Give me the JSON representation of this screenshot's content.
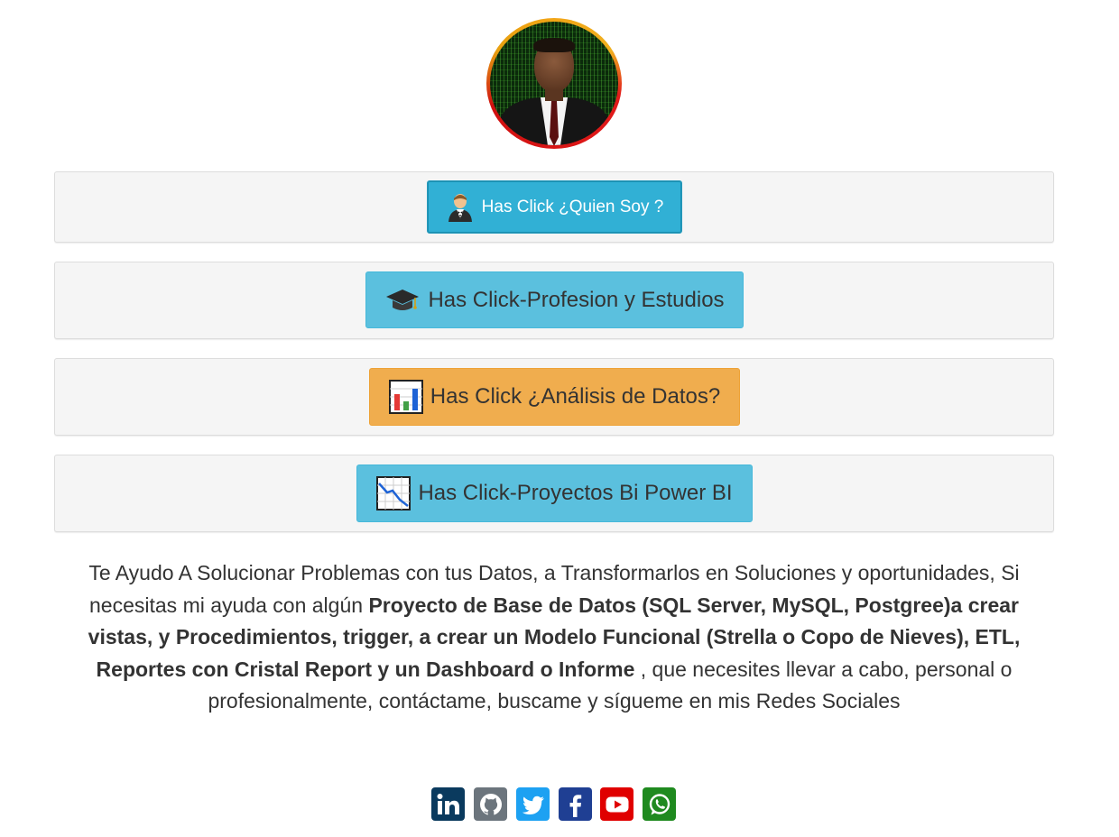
{
  "profile": {
    "photo_alt": "profile photo"
  },
  "buttons": [
    {
      "label": "Has Click ¿Quien Soy ?",
      "icon": "man-in-tuxedo-icon",
      "color": "#31b0d5"
    },
    {
      "label": "Has Click-Profesion y Estudios",
      "icon": "graduation-cap-icon",
      "color": "#5bc0de"
    },
    {
      "label": "Has Click ¿Análisis de Datos?",
      "icon": "bar-chart-icon",
      "color": "#f0ad4e"
    },
    {
      "label": "Has Click-Proyectos Bi Power BI",
      "icon": "chart-decreasing-icon",
      "color": "#5bc0de"
    }
  ],
  "description": {
    "part1": "Te Ayudo A Solucionar Problemas con tus Datos, a Transformarlos en Soluciones y oportunidades, Si necesitas mi ayuda con algún ",
    "bold": "Proyecto de Base de Datos (SQL Server, MySQL, Postgree)a crear vistas, y Procedimientos, trigger, a crear un Modelo Funcional (Strella o Copo de Nieves), ETL, Reportes con Cristal Report y un Dashboard o Informe",
    "part2": " , que necesites llevar a cabo, personal o profesionalmente, contáctame, buscame y sígueme en mis Redes Sociales"
  },
  "social": [
    {
      "name": "linkedin",
      "color": "#0a3a5e"
    },
    {
      "name": "github",
      "color": "#6c757d"
    },
    {
      "name": "twitter",
      "color": "#1da1f2"
    },
    {
      "name": "facebook",
      "color": "#1f3f93"
    },
    {
      "name": "youtube",
      "color": "#e00000"
    },
    {
      "name": "whatsapp",
      "color": "#1f8a1f"
    }
  ]
}
